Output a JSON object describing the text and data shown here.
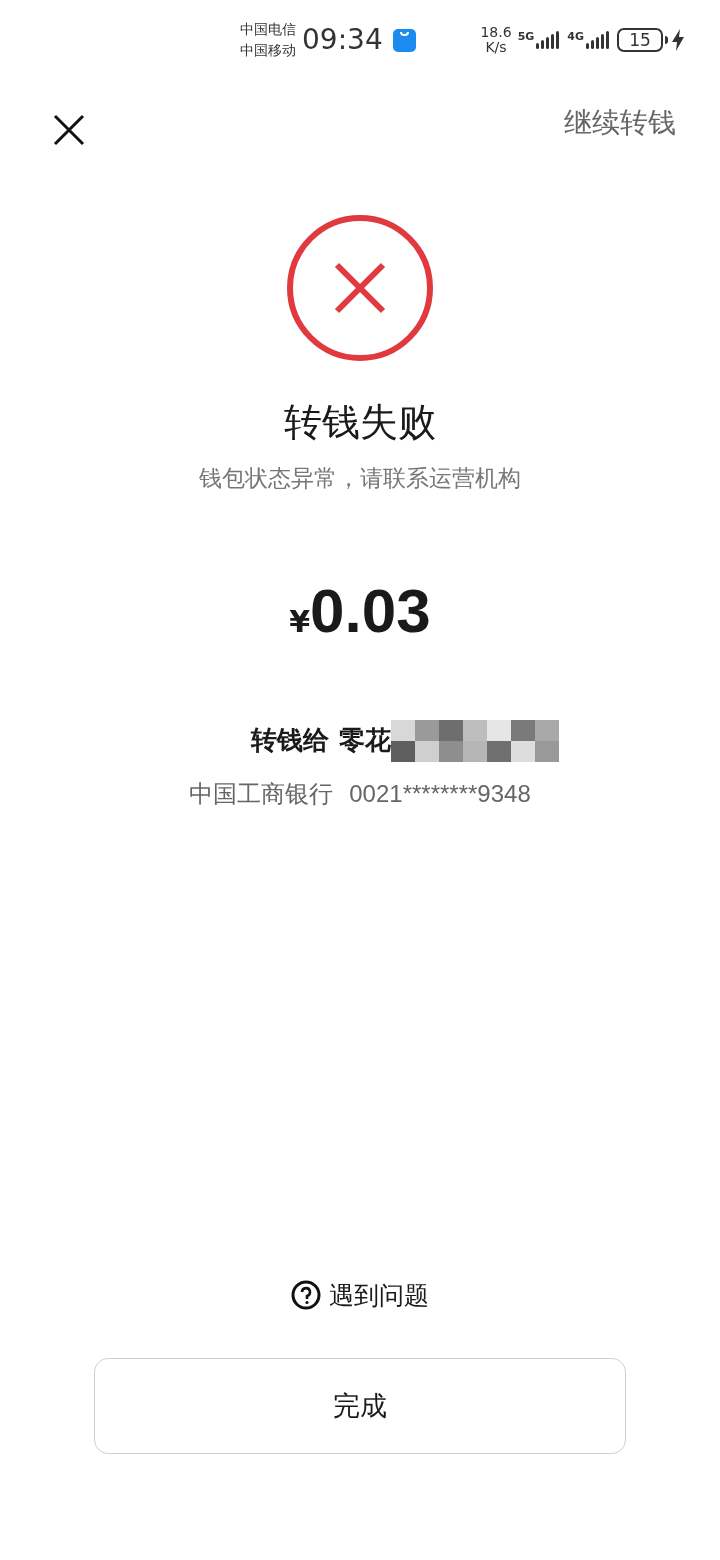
{
  "status_bar": {
    "carriers": [
      "中国电信",
      "中国移动"
    ],
    "time": "09:34",
    "speed": "18.6",
    "speed_unit": "K/s",
    "networks": [
      "5G",
      "4G"
    ],
    "battery": "15",
    "charging": true
  },
  "header": {
    "action": "继续转钱"
  },
  "result": {
    "failed": true,
    "title": "转钱失败",
    "message": "钱包状态异常，请联系运营机构"
  },
  "amount": {
    "currency": "¥",
    "value": "0.03"
  },
  "recipient": {
    "prefix": "转钱给",
    "name": "零花",
    "redacted": true,
    "bank": "中国工商银行",
    "account": "0021********9348"
  },
  "help": {
    "label": "遇到问题"
  },
  "buttons": [
    {
      "label": "完成"
    }
  ]
}
